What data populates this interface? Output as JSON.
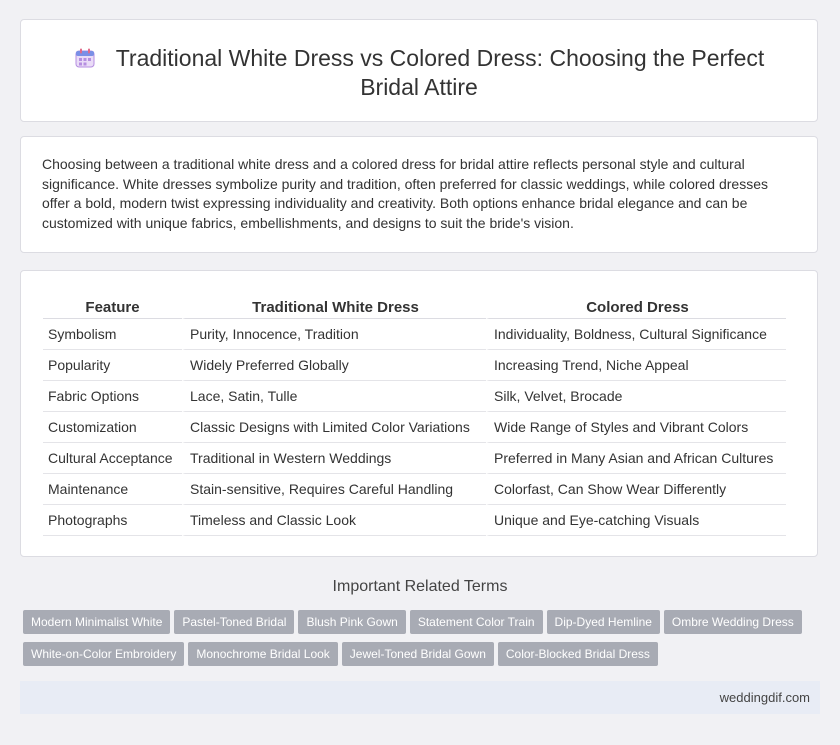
{
  "header": {
    "title": "Traditional White Dress vs Colored Dress: Choosing the Perfect Bridal Attire",
    "icon": "calendar-icon"
  },
  "intro": {
    "text": "Choosing between a traditional white dress and a colored dress for bridal attire reflects personal style and cultural significance. White dresses symbolize purity and tradition, often preferred for classic weddings, while colored dresses offer a bold, modern twist expressing individuality and creativity. Both options enhance bridal elegance and can be customized with unique fabrics, embellishments, and designs to suit the bride's vision."
  },
  "table": {
    "headers": [
      "Feature",
      "Traditional White Dress",
      "Colored Dress"
    ],
    "rows": [
      [
        "Symbolism",
        "Purity, Innocence, Tradition",
        "Individuality, Boldness, Cultural Significance"
      ],
      [
        "Popularity",
        "Widely Preferred Globally",
        "Increasing Trend, Niche Appeal"
      ],
      [
        "Fabric Options",
        "Lace, Satin, Tulle",
        "Silk, Velvet, Brocade"
      ],
      [
        "Customization",
        "Classic Designs with Limited Color Variations",
        "Wide Range of Styles and Vibrant Colors"
      ],
      [
        "Cultural Acceptance",
        "Traditional in Western Weddings",
        "Preferred in Many Asian and African Cultures"
      ],
      [
        "Maintenance",
        "Stain-sensitive, Requires Careful Handling",
        "Colorfast, Can Show Wear Differently"
      ],
      [
        "Photographs",
        "Timeless and Classic Look",
        "Unique and Eye-catching Visuals"
      ]
    ]
  },
  "related": {
    "title": "Important Related Terms",
    "tags": [
      "Modern Minimalist White",
      "Pastel-Toned Bridal",
      "Blush Pink Gown",
      "Statement Color Train",
      "Dip-Dyed Hemline",
      "Ombre Wedding Dress",
      "White-on-Color Embroidery",
      "Monochrome Bridal Look",
      "Jewel-Toned Bridal Gown",
      "Color-Blocked Bridal Dress"
    ]
  },
  "footer": {
    "site": "weddingdif.com"
  },
  "colors": {
    "tag_bg": "#a8abb4",
    "footer_bg": "#e8ecf5",
    "page_bg": "#f1f1f4"
  }
}
